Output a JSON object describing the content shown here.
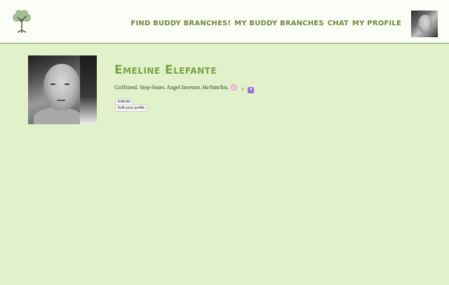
{
  "header": {
    "logo_icon": "tree-icon",
    "nav": [
      {
        "label": "Find buddy branches!"
      },
      {
        "label": "My buddy branches"
      },
      {
        "label": "Chat"
      },
      {
        "label": "My profile"
      }
    ],
    "avatar_icon": "user-avatar"
  },
  "profile": {
    "name": "Emeline Elefante",
    "bio": "Girlfriend. Step-Sister. Angel Investor. He/him/his.",
    "bio_emojis": [
      "bear-face-icon",
      "music-notes-icon",
      "heart-icon"
    ],
    "edit_bio_label": "Edit bio",
    "edit_profile_label": "Edit your profile"
  },
  "colors": {
    "background": "#e1f2ca",
    "header_bg": "#fbfef6",
    "accent": "#7aa043",
    "nav_text": "#6a8a3b"
  }
}
